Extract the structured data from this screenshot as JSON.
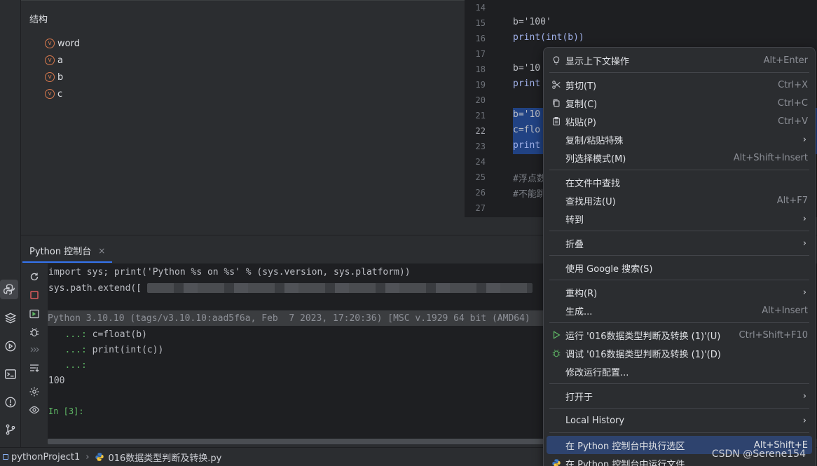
{
  "structure": {
    "title": "结构",
    "items": [
      {
        "badge": "v",
        "label": "word"
      },
      {
        "badge": "v",
        "label": "a"
      },
      {
        "badge": "v",
        "label": "b"
      },
      {
        "badge": "v",
        "label": "c"
      }
    ]
  },
  "editor": {
    "lines": [
      {
        "num": "14",
        "code": ""
      },
      {
        "num": "15",
        "code": "b='100'"
      },
      {
        "num": "16",
        "code": "print(int(b))"
      },
      {
        "num": "17",
        "code": ""
      },
      {
        "num": "18",
        "code": "b='10"
      },
      {
        "num": "19",
        "code": "print"
      },
      {
        "num": "20",
        "code": ""
      },
      {
        "num": "21",
        "code": "b='10"
      },
      {
        "num": "22",
        "code": "c=flo"
      },
      {
        "num": "23",
        "code": "print"
      },
      {
        "num": "24",
        "code": ""
      },
      {
        "num": "25",
        "code": "#浮点数"
      },
      {
        "num": "26",
        "code": "#不能跳"
      },
      {
        "num": "27",
        "code": ""
      }
    ]
  },
  "console": {
    "tab_label": "Python 控制台",
    "tab_close": "×",
    "lines": {
      "l1": "import sys; print('Python %s on %s' % (sys.version, sys.platform))",
      "l2": "sys.path.extend([",
      "banner": "Python 3.10.10 (tags/v3.10.10:aad5f6a, Feb  7 2023, 17:20:36) [MSC v.1929 64 bit (AMD64)",
      "cont_prefix": "   ...:",
      "c1": " c=float(b)",
      "c2": " print(int(c))",
      "c3": "",
      "output": "100",
      "prompt": "In [3]:"
    }
  },
  "statusbar": {
    "project": "pythonProject1",
    "chevron": "›",
    "file": "016数据类型判断及转换.py"
  },
  "watermark": "CSDN @Serene154",
  "context_menu": {
    "items": {
      "show_context_actions": {
        "label": "显示上下文操作",
        "shortcut": "Alt+Enter"
      },
      "cut": {
        "label": "剪切(T)",
        "shortcut": "Ctrl+X"
      },
      "copy": {
        "label": "复制(C)",
        "shortcut": "Ctrl+C"
      },
      "paste": {
        "label": "粘贴(P)",
        "shortcut": "Ctrl+V"
      },
      "copy_paste_special": {
        "label": "复制/粘贴特殊",
        "shortcut": ""
      },
      "column_selection": {
        "label": "列选择模式(M)",
        "shortcut": "Alt+Shift+Insert"
      },
      "find_in_files": {
        "label": "在文件中查找",
        "shortcut": ""
      },
      "find_usages": {
        "label": "查找用法(U)",
        "shortcut": "Alt+F7"
      },
      "goto": {
        "label": "转到",
        "shortcut": ""
      },
      "folding": {
        "label": "折叠",
        "shortcut": ""
      },
      "google_search": {
        "label": "使用 Google 搜索(S)",
        "shortcut": ""
      },
      "refactor": {
        "label": "重构(R)",
        "shortcut": ""
      },
      "generate": {
        "label": "生成...",
        "shortcut": "Alt+Insert"
      },
      "run": {
        "label": "运行 '016数据类型判断及转换 (1)'(U)",
        "shortcut": "Ctrl+Shift+F10"
      },
      "debug": {
        "label": "调试 '016数据类型判断及转换 (1)'(D)",
        "shortcut": ""
      },
      "modify_run_config": {
        "label": "修改运行配置...",
        "shortcut": ""
      },
      "open_in": {
        "label": "打开于",
        "shortcut": ""
      },
      "local_history": {
        "label": "Local History",
        "shortcut": ""
      },
      "execute_selection": {
        "label": "在 Python 控制台中执行选区",
        "shortcut": "Alt+Shift+E"
      },
      "run_file_in_console": {
        "label": "在 Python 控制台中运行文件",
        "shortcut": ""
      }
    },
    "submenu_arrow": "›"
  },
  "colors": {
    "accent": "#3574f0",
    "highlight": "#2e436e",
    "selection": "#214283",
    "background": "#1e1f22",
    "panel": "#2b2d30"
  }
}
